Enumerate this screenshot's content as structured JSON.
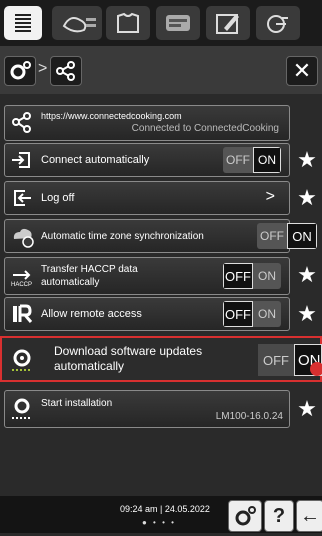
{
  "topbar": {
    "tabs": [
      {
        "icon": "list-icon",
        "active": true
      },
      {
        "icon": "meat-icon",
        "active": false
      },
      {
        "icon": "shirt-icon",
        "active": false
      },
      {
        "icon": "gauge-icon",
        "active": false
      },
      {
        "icon": "edit-icon",
        "active": false
      },
      {
        "icon": "power-icon",
        "active": false
      }
    ]
  },
  "subbar": {
    "settings_icon": "settings-icon",
    "separator": ">",
    "share_icon": "share-icon",
    "close_label": "✕"
  },
  "rows": [
    {
      "type": "link",
      "url": "https://www.connectedcooking.com",
      "status": "Connected to ConnectedCooking"
    },
    {
      "type": "toggle",
      "label": "Connect automatically",
      "off": "OFF",
      "on": "ON",
      "state": "on"
    },
    {
      "type": "action",
      "label": "Log off",
      "arrow": ">"
    },
    {
      "type": "toggle",
      "label": "Automatic time zone synchronization",
      "off": "OFF",
      "on": "ON",
      "state": "on"
    },
    {
      "type": "toggle",
      "label": "Transfer HACCP data automatically",
      "off": "OFF",
      "on": "ON",
      "state": "off"
    },
    {
      "type": "toggle",
      "label": "Allow remote access",
      "off": "OFF",
      "on": "ON",
      "state": "off"
    },
    {
      "type": "toggle",
      "label": "Download software updates automatically",
      "off": "OFF",
      "on": "ON",
      "state": "on"
    },
    {
      "type": "info",
      "label": "Start installation",
      "version": "LM100-16.0.24"
    }
  ],
  "bottombar": {
    "datetime": "09:24 am | 24.05.2022",
    "settings_icon": "settings-icon",
    "help_label": "?",
    "back_label": "←"
  }
}
